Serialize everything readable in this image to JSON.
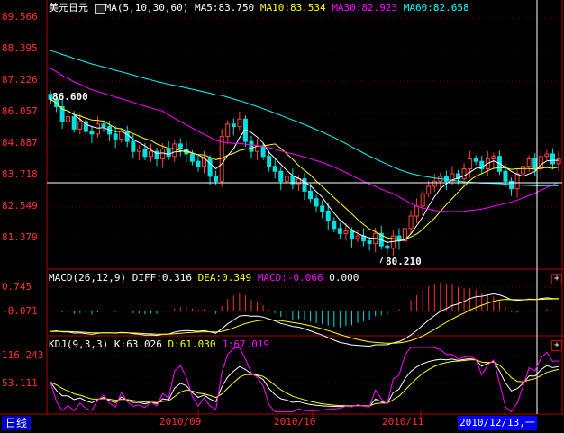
{
  "main_panel": {
    "symbol": "美元日元",
    "ma_indicator_label": "MA(5,10,30,60)",
    "ma5": "MA5:83.750",
    "ma10": "MA10:83.534",
    "ma30": "MA30:82.923",
    "ma60": "MA60:82.658",
    "y_ticks": [
      "89.566",
      "88.395",
      "87.226",
      "86.057",
      "84.887",
      "83.718",
      "82.549",
      "81.379"
    ],
    "high_marker": "86.600",
    "low_marker": "80.210",
    "colors": {
      "ma5": "#ffffff",
      "ma10": "#ffff00",
      "ma30": "#ff00ff",
      "ma60": "#00ffff"
    }
  },
  "macd_panel": {
    "label": "MACD(26,12,9)",
    "diff": "DIFF:0.316",
    "dea": "DEA:0.349",
    "macd": "MACD:-0.066",
    "extra": "0.000",
    "y_ticks": [
      "0.745",
      "-0.071"
    ],
    "plus_label": "+"
  },
  "kdj_panel": {
    "label": "KDJ(9,3,3)",
    "k": "K:63.026",
    "d": "D:61.030",
    "j": "J:67.019",
    "y_ticks": [
      "116.243",
      "53.111"
    ],
    "plus_label": "+"
  },
  "period_label": "日线",
  "x_ticks": [
    "2010/09",
    "2010/10",
    "2010/11"
  ],
  "cursor_date": "2010/12/13,一",
  "chart_data": {
    "type": "candlestick",
    "ylim": [
      79.5,
      89.566
    ],
    "closes": [
      86.3,
      86.0,
      85.4,
      85.6,
      85.1,
      85.4,
      85.0,
      84.9,
      85.3,
      85.2,
      84.9,
      84.7,
      85.0,
      84.6,
      84.2,
      84.3,
      84.0,
      84.2,
      83.9,
      84.3,
      84.0,
      84.5,
      84.3,
      84.1,
      83.8,
      83.6,
      83.9,
      83.2,
      83.0,
      84.8,
      85.3,
      85.2,
      85.5,
      84.6,
      84.2,
      84.4,
      84.0,
      83.6,
      83.4,
      83.0,
      83.2,
      82.9,
      83.1,
      82.6,
      82.3,
      82.0,
      81.8,
      81.4,
      81.1,
      80.9,
      81.0,
      80.7,
      80.8,
      80.6,
      80.5,
      80.9,
      80.4,
      80.3,
      80.8,
      80.6,
      81.1,
      81.6,
      82.0,
      82.5,
      82.8,
      83.0,
      83.2,
      83.0,
      83.3,
      83.1,
      83.5,
      83.9,
      83.8,
      83.5,
      83.9,
      84.0,
      83.4,
      83.0,
      82.7,
      83.3,
      83.6,
      83.9,
      83.5,
      84.0,
      84.1,
      83.7,
      83.9
    ]
  }
}
